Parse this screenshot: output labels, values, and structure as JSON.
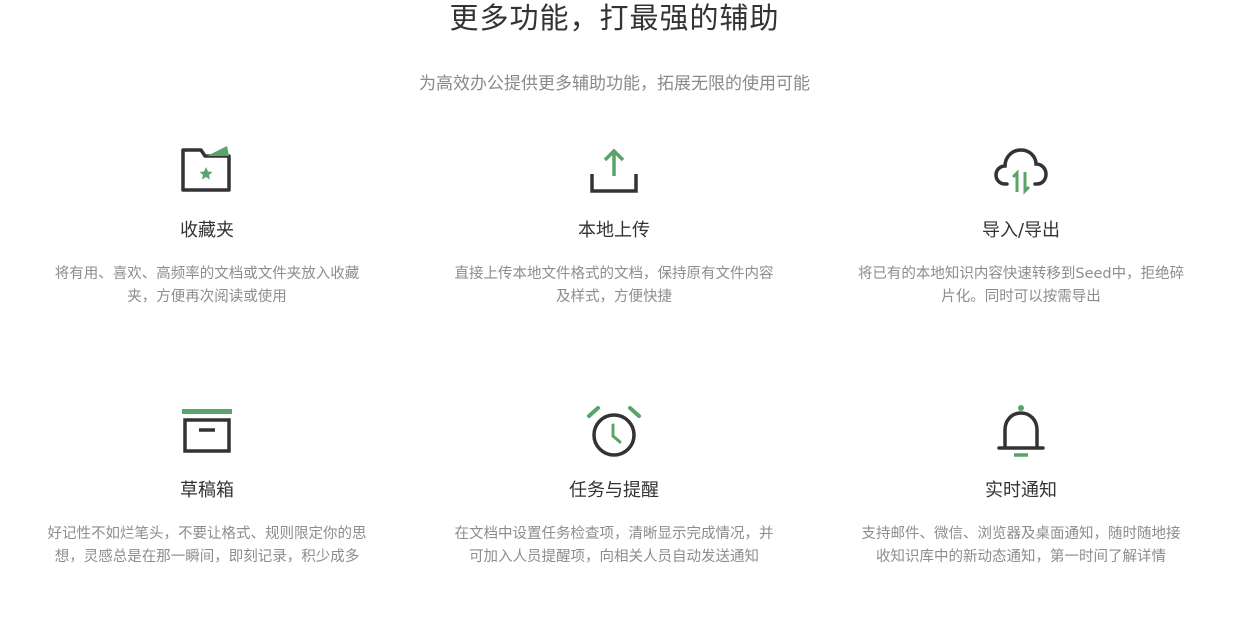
{
  "header": {
    "title": "更多功能，打最强的辅助",
    "subtitle": "为高效办公提供更多辅助功能，拓展无限的使用可能"
  },
  "colors": {
    "accent": "#5aa469",
    "icon_dark": "#333333"
  },
  "features": [
    {
      "icon": "favorites-folder-icon",
      "title": "收藏夹",
      "desc": "将有用、喜欢、高频率的文档或文件夹放入收藏夹，方便再次阅读或使用"
    },
    {
      "icon": "upload-icon",
      "title": "本地上传",
      "desc": "直接上传本地文件格式的文档，保持原有文件内容及样式，方便快捷"
    },
    {
      "icon": "cloud-transfer-icon",
      "title": "导入/导出",
      "desc": "将已有的本地知识内容快速转移到Seed中，拒绝碎片化。同时可以按需导出"
    },
    {
      "icon": "archive-box-icon",
      "title": "草稿箱",
      "desc": "好记性不如烂笔头，不要让格式、规则限定你的思想，灵感总是在那一瞬间，即刻记录，积少成多"
    },
    {
      "icon": "alarm-clock-icon",
      "title": "任务与提醒",
      "desc": "在文档中设置任务检查项，清晰显示完成情况，并可加入人员提醒项，向相关人员自动发送通知"
    },
    {
      "icon": "bell-icon",
      "title": "实时通知",
      "desc": "支持邮件、微信、浏览器及桌面通知，随时随地接收知识库中的新动态通知，第一时间了解详情"
    }
  ]
}
